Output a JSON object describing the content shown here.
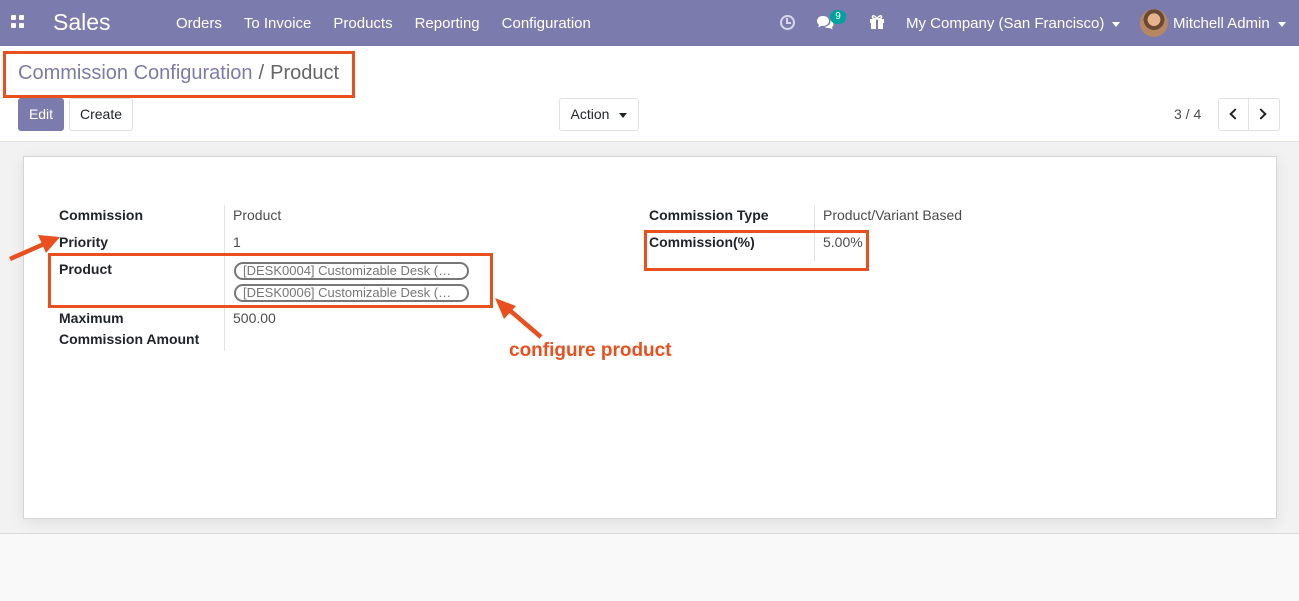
{
  "navbar": {
    "app_name": "Sales",
    "menu": [
      "Orders",
      "To Invoice",
      "Products",
      "Reporting",
      "Configuration"
    ],
    "message_count": "9",
    "company": "My Company (San Francisco)",
    "user": "Mitchell Admin",
    "icons": [
      "apps-grid-icon",
      "clock-icon",
      "chat-icon",
      "gift-icon"
    ]
  },
  "breadcrumb": {
    "parent": "Commission Configuration",
    "separator": "/",
    "current": "Product"
  },
  "toolbar": {
    "edit_label": "Edit",
    "create_label": "Create",
    "action_label": "Action"
  },
  "pager": {
    "value": "3 / 4"
  },
  "form": {
    "commission": {
      "label": "Commission",
      "value": "Product"
    },
    "priority": {
      "label": "Priority",
      "value": "1"
    },
    "product": {
      "label": "Product",
      "tags": [
        "[DESK0004] Customizable Desk (…",
        "[DESK0006] Customizable Desk (…"
      ]
    },
    "max_commission": {
      "label_line1": "Maximum",
      "label_line2": "Commission Amount",
      "value": "500.00"
    },
    "commission_type": {
      "label": "Commission Type",
      "value": "Product/Variant Based"
    },
    "commission_percent": {
      "label": "Commission(%)",
      "value": "5.00%"
    }
  },
  "annotation": {
    "text": "configure product",
    "color": "#e9501e"
  },
  "colors": {
    "navbar": "#7c7bad",
    "primary": "#7c7bad",
    "badge": "#00a09d"
  }
}
